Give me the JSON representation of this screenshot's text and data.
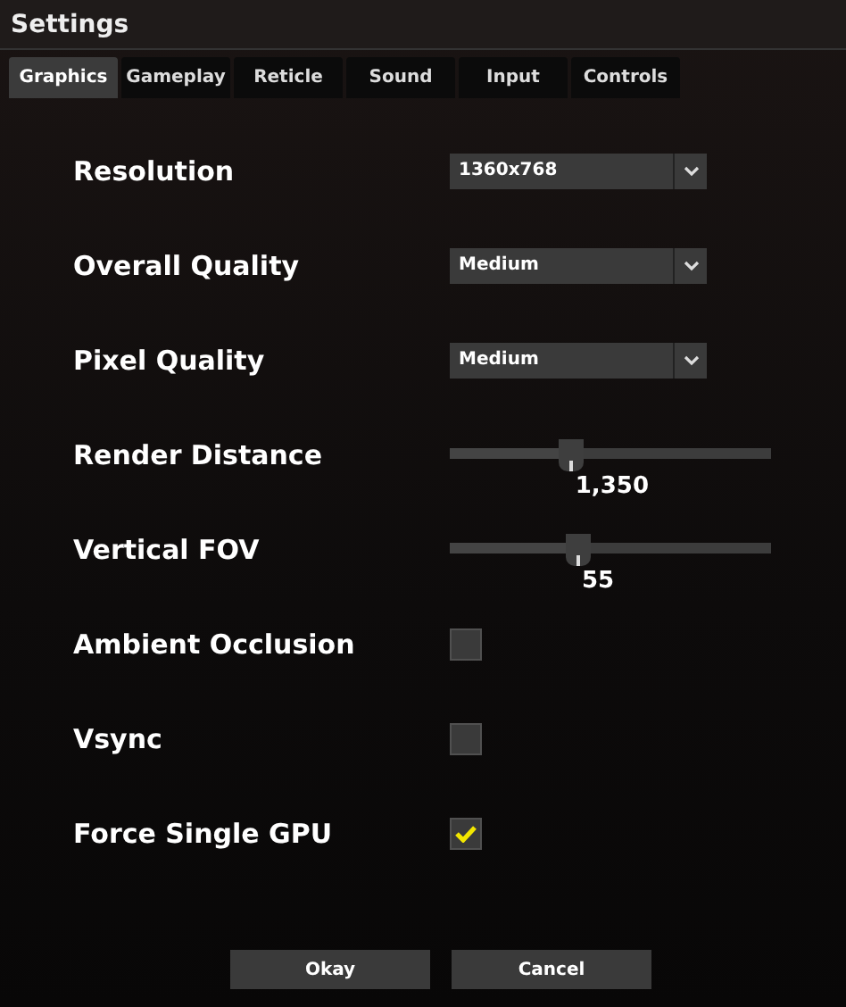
{
  "window": {
    "title": "Settings"
  },
  "tabs": [
    {
      "label": "Graphics",
      "selected": true
    },
    {
      "label": "Gameplay",
      "selected": false
    },
    {
      "label": "Reticle",
      "selected": false
    },
    {
      "label": "Sound",
      "selected": false
    },
    {
      "label": "Input",
      "selected": false
    },
    {
      "label": "Controls",
      "selected": false
    }
  ],
  "settings": [
    {
      "kind": "dropdown",
      "label": "Resolution",
      "value": "1360x768"
    },
    {
      "kind": "dropdown",
      "label": "Overall Quality",
      "value": "Medium"
    },
    {
      "kind": "dropdown",
      "label": "Pixel Quality",
      "value": "Medium"
    },
    {
      "kind": "slider",
      "label": "Render Distance",
      "level": 0.38,
      "reading": "1,350"
    },
    {
      "kind": "slider",
      "label": "Vertical FOV",
      "level": 0.4,
      "reading": "55"
    },
    {
      "kind": "checkbox",
      "label": "Ambient Occlusion",
      "checked": false
    },
    {
      "kind": "checkbox",
      "label": "Vsync",
      "checked": false
    },
    {
      "kind": "checkbox",
      "label": "Force Single GPU",
      "checked": true
    }
  ],
  "buttons": [
    "Okay",
    "Cancel"
  ]
}
